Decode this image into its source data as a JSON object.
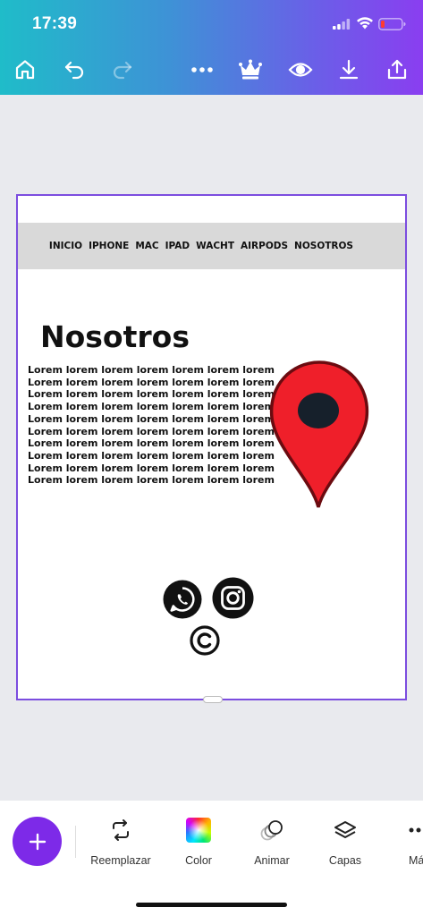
{
  "status_bar": {
    "time": "17:39"
  },
  "toolbar": {
    "icons": [
      "home-icon",
      "undo-icon",
      "redo-icon",
      "more-icon",
      "crown-icon",
      "eye-icon",
      "download-icon",
      "share-icon"
    ]
  },
  "design": {
    "nav_items": [
      "INICIO",
      "IPHONE",
      "MAC",
      "IPAD",
      "WACHT",
      "AIRPODS",
      "NOSOTROS"
    ],
    "heading": "Nosotros",
    "lorem_lines": [
      "Lorem lorem lorem lorem lorem lorem lorem",
      "Lorem lorem lorem lorem lorem lorem lorem",
      "Lorem lorem lorem lorem lorem lorem lorem",
      "Lorem lorem lorem lorem lorem lorem lorem",
      "Lorem lorem lorem lorem lorem lorem lorem",
      "Lorem lorem lorem lorem lorem lorem lorem",
      "Lorem lorem lorem lorem lorem lorem lorem",
      "Lorem lorem lorem lorem lorem lorem lorem",
      "Lorem lorem lorem lorem lorem lorem lorem",
      "Lorem lorem lorem lorem lorem lorem lorem"
    ],
    "pin_color": "#ef1f2a",
    "accent": "#7c4ddf"
  },
  "bottom_toolbar": {
    "add_label": "+",
    "tools": [
      {
        "label": "Reemplazar",
        "icon": "replace-icon"
      },
      {
        "label": "Color",
        "icon": "color-icon"
      },
      {
        "label": "Animar",
        "icon": "animate-icon"
      },
      {
        "label": "Capas",
        "icon": "layers-icon"
      },
      {
        "label": "Má",
        "icon": "more-icon"
      }
    ]
  }
}
